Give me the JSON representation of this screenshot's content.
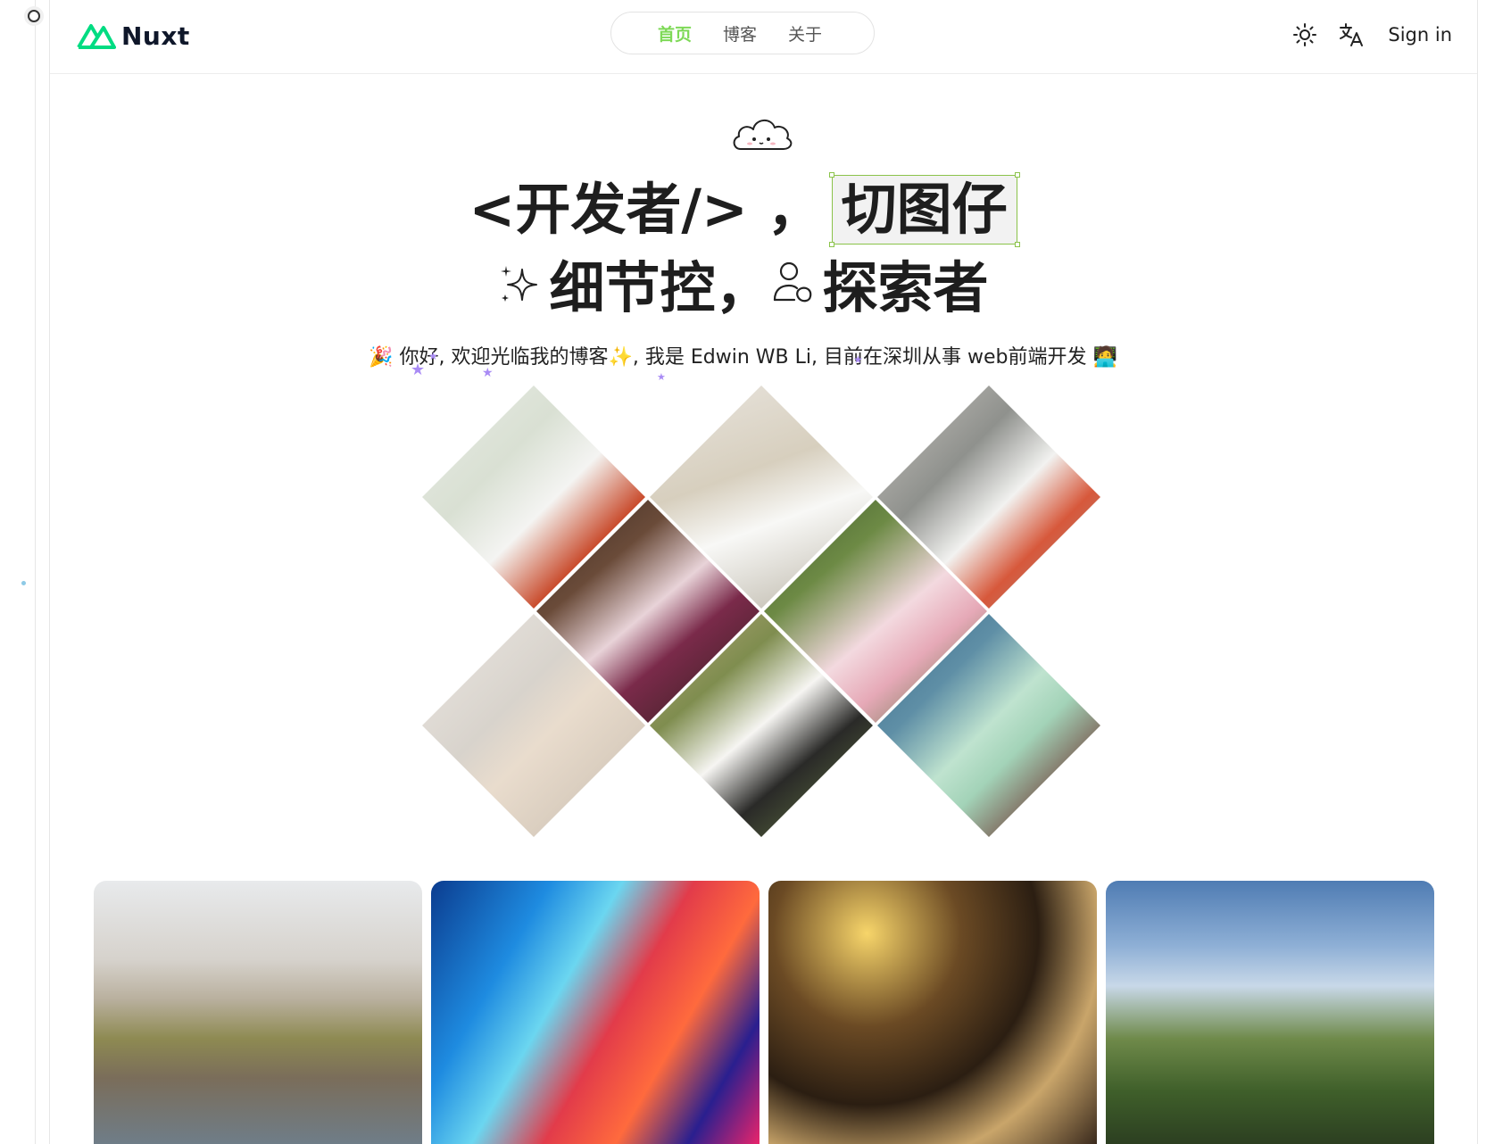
{
  "header": {
    "logo_text": "Nuxt",
    "nav": [
      {
        "label": "首页",
        "active": true
      },
      {
        "label": "博客",
        "active": false
      },
      {
        "label": "关于",
        "active": false
      }
    ],
    "theme_icon": "sun-icon",
    "translate_icon": "translate-icon",
    "sign_in": "Sign in"
  },
  "hero": {
    "line1_prefix": "<开发者/> ，",
    "line1_highlight": "切图仔",
    "line2_part1": "细节控，",
    "line2_part2": "探索者",
    "intro": "🎉 你好, 欢迎光临我的博客✨, 我是 Edwin WB Li, 目前在深圳从事 web前端开发 🧑‍💻",
    "icons": [
      "cloud-mascot-icon",
      "sparkle-icon",
      "people-icon"
    ]
  },
  "collage": {
    "photos": [
      "woman-white-dress-red-flowers",
      "woman-white-dress-seated-bench",
      "woman-white-dress-holding-flowers",
      "woman-floral-qipao",
      "woman-pink-dress-garden",
      "woman-satin-slip-dress",
      "woman-white-dress-reading-book",
      "woman-mint-dress-colorful-wall"
    ]
  },
  "gallery": {
    "cards": [
      "lucerne-chapel-bridge",
      "colorful-ink-smoke",
      "party-string-lights-champagne",
      "green-mountain-blue-sky"
    ]
  },
  "colors": {
    "nuxt_green": "#00dc82",
    "nav_active": "#7ed957",
    "selection_border": "#8bc34a",
    "star_purple": "#a98bf5"
  }
}
